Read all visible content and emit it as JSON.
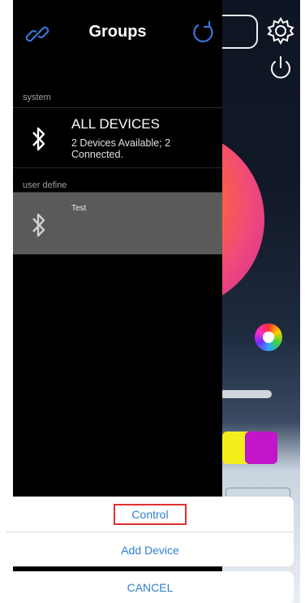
{
  "drawer": {
    "title": "Groups",
    "sections": {
      "system": "system",
      "user_define": "user define"
    },
    "groups": [
      {
        "name": "ALL DEVICES",
        "status": "2 Devices Available; 2 Connected."
      },
      {
        "name": "Test",
        "status": ""
      }
    ]
  },
  "action_sheet": {
    "control_label": "Control",
    "add_device_label": "Add Device",
    "cancel_label": "CANCEL"
  },
  "colors": {
    "accent_blue": "#2f7fd0",
    "highlight_red": "#e03030",
    "selected_row": "#5a5a5a"
  },
  "icons": [
    "link-icon",
    "refresh-icon",
    "bluetooth-icon",
    "gear-icon",
    "power-icon",
    "color-wheel-icon"
  ]
}
